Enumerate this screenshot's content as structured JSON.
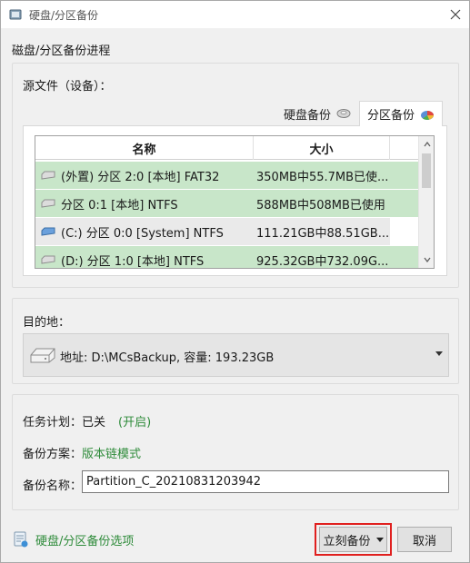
{
  "window": {
    "title": "硬盘/分区备份",
    "close_glyph": "✕"
  },
  "section_heading": "磁盘/分区备份进程",
  "source": {
    "label": "源文件（设备）：",
    "tabs": [
      {
        "label": "硬盘备份",
        "icon": "hard-disk-icon",
        "selected": false
      },
      {
        "label": "分区备份",
        "icon": "partition-pie-icon",
        "selected": true
      }
    ],
    "columns": [
      "名称",
      "大小"
    ],
    "rows": [
      {
        "name": "(外置) 分区 2:0 [本地] FAT32",
        "size": "350MB中55.7MB已使...",
        "state": "checked"
      },
      {
        "name": "分区 0:1 [本地] NTFS",
        "size": "588MB中508MB已使用",
        "state": "checked"
      },
      {
        "name": "(C:) 分区 0:0 [System] NTFS",
        "size": "111.21GB中88.51GB...",
        "state": "selected"
      },
      {
        "name": "(D:) 分区 1:0 [本地] NTFS",
        "size": "925.32GB中732.09G...",
        "state": "checked"
      }
    ]
  },
  "destination": {
    "label": "目的地：",
    "value": "地址: D:\\MCsBackup, 容量: 193.23GB"
  },
  "schedule": {
    "label": "任务计划：",
    "value": "已关",
    "link": "(开启)"
  },
  "scheme": {
    "label": "备份方案：",
    "link": "版本链模式"
  },
  "backup_name": {
    "label": "备份名称：",
    "value": "Partition_C_20210831203942"
  },
  "footer": {
    "options_link": "硬盘/分区备份选项",
    "backup_button": "立刻备份",
    "cancel_button": "取消"
  },
  "colors": {
    "row_checked": "#c8e6c9",
    "row_selected": "#eaeaea",
    "link_green": "#2e8b3a",
    "highlight_red": "#e0201f"
  }
}
